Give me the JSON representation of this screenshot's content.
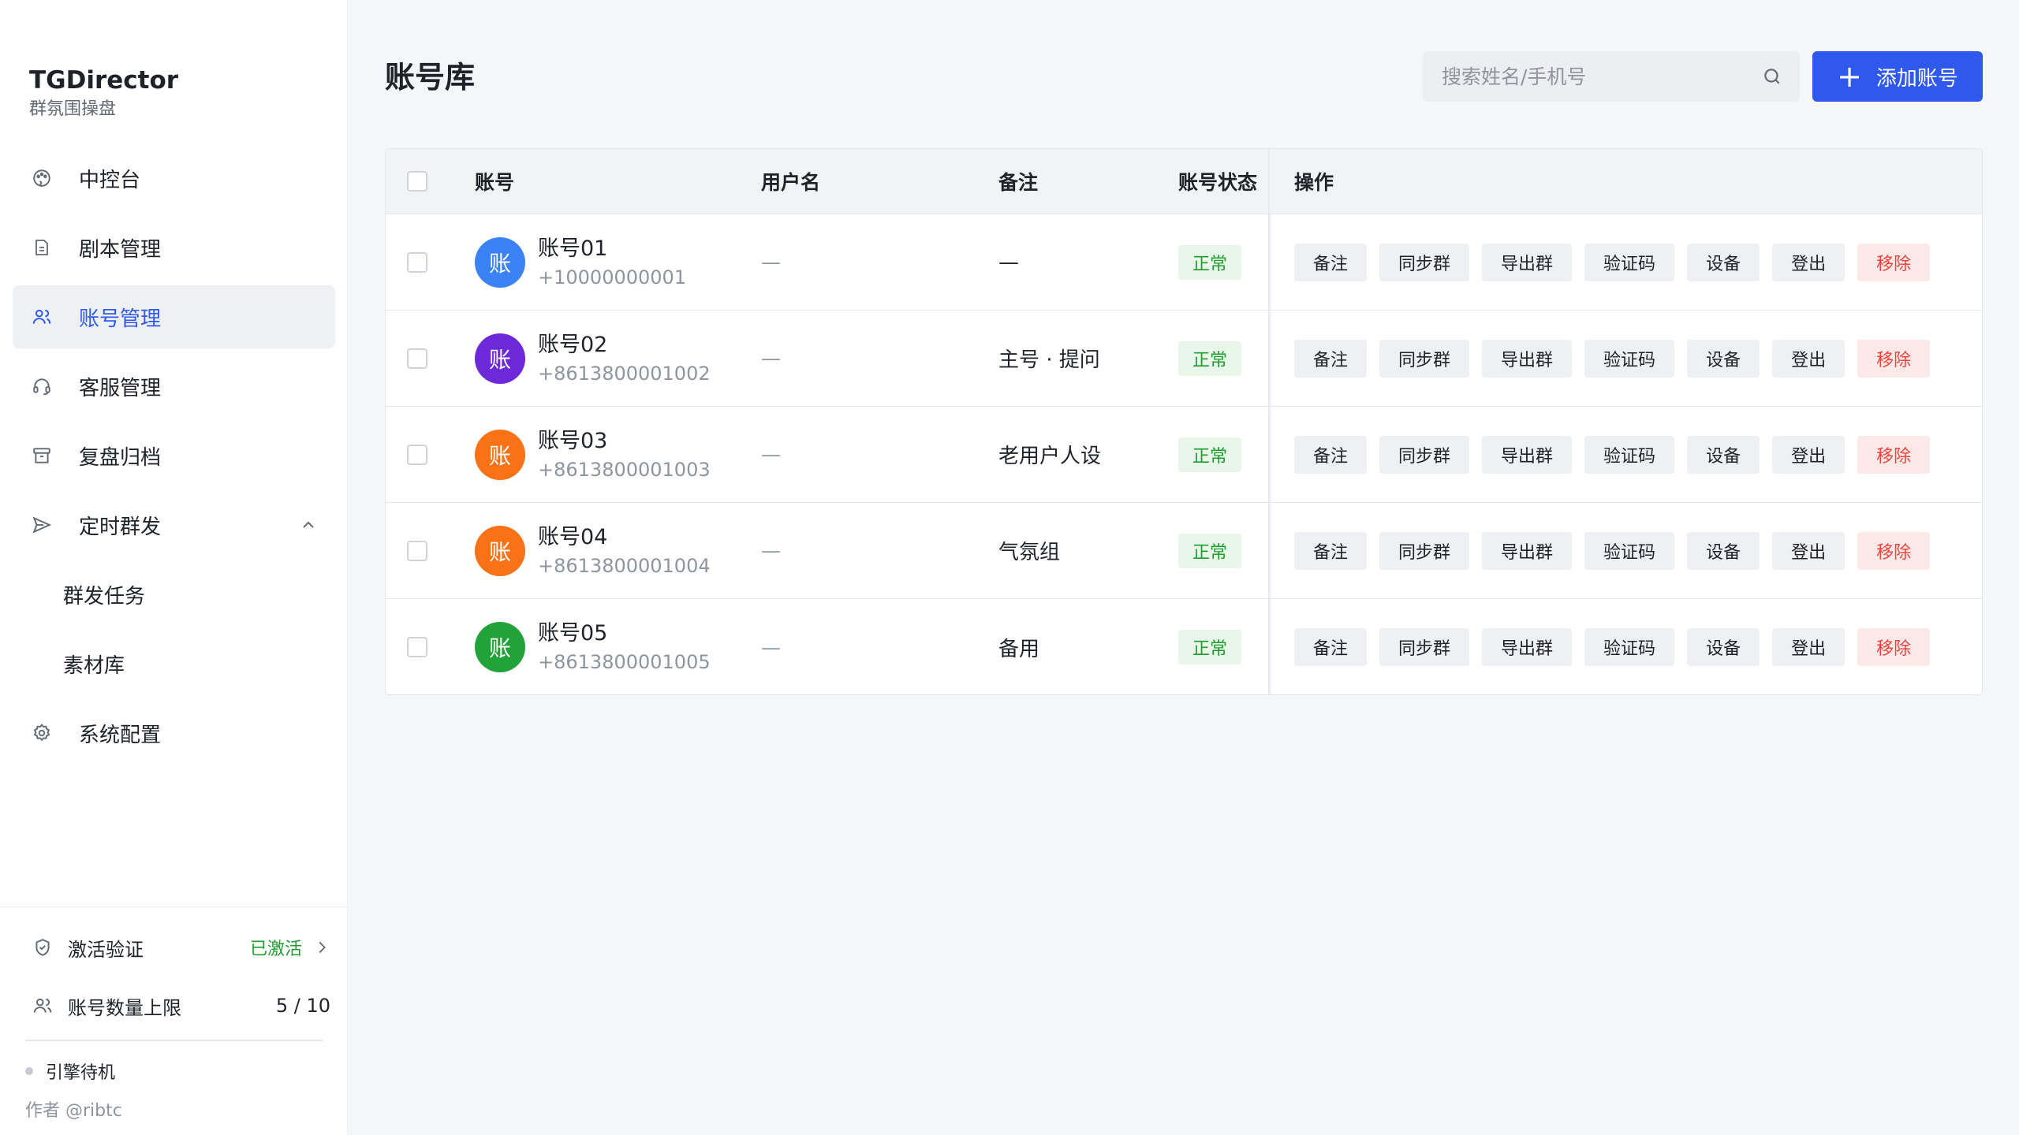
{
  "brand": {
    "title": "TGDirector",
    "subtitle": "群氛围操盘"
  },
  "sidebar": {
    "items": [
      {
        "label": "中控台",
        "icon": "palette-icon"
      },
      {
        "label": "剧本管理",
        "icon": "document-icon"
      },
      {
        "label": "账号管理",
        "icon": "users-icon",
        "active": true
      },
      {
        "label": "客服管理",
        "icon": "headset-icon"
      },
      {
        "label": "复盘归档",
        "icon": "archive-icon"
      },
      {
        "label": "定时群发",
        "icon": "send-icon",
        "expanded": true
      }
    ],
    "subitems": [
      {
        "label": "群发任务"
      },
      {
        "label": "素材库"
      }
    ],
    "settings": {
      "label": "系统配置",
      "icon": "gear-icon"
    },
    "footer": {
      "activation_label": "激活验证",
      "activation_status": "已激活",
      "limit_label": "账号数量上限",
      "limit_value": "5 / 10",
      "engine_status": "引擎待机",
      "author": "作者 @ribtc"
    }
  },
  "page": {
    "title": "账号库"
  },
  "search": {
    "placeholder": "搜索姓名/手机号"
  },
  "actions": {
    "add_label": "添加账号"
  },
  "table": {
    "headers": {
      "account": "账号",
      "username": "用户名",
      "note": "备注",
      "status": "账号状态",
      "ops": "操作"
    },
    "op_labels": [
      "备注",
      "同步群",
      "导出群",
      "验证码",
      "设备",
      "登出",
      "移除"
    ],
    "rows": [
      {
        "avatar": "账",
        "avatar_color": "#3b82f6",
        "name": "账号01",
        "phone": "+10000000001",
        "username": "—",
        "note": "—",
        "status": "正常"
      },
      {
        "avatar": "账",
        "avatar_color": "#6d28d9",
        "name": "账号02",
        "phone": "+8613800001002",
        "username": "—",
        "note": "主号 · 提问",
        "status": "正常"
      },
      {
        "avatar": "账",
        "avatar_color": "#f97316",
        "name": "账号03",
        "phone": "+8613800001003",
        "username": "—",
        "note": "老用户人设",
        "status": "正常"
      },
      {
        "avatar": "账",
        "avatar_color": "#f97316",
        "name": "账号04",
        "phone": "+8613800001004",
        "username": "—",
        "note": "气氛组",
        "status": "正常"
      },
      {
        "avatar": "账",
        "avatar_color": "#22a33a",
        "name": "账号05",
        "phone": "+8613800001005",
        "username": "—",
        "note": "备用",
        "status": "正常"
      }
    ]
  },
  "colors": {
    "accent": "#2e59ec",
    "success": "#1f9d2f",
    "danger": "#f0443e"
  }
}
